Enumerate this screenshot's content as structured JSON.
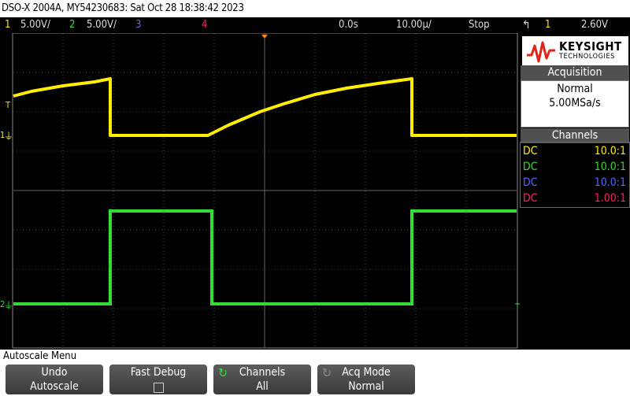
{
  "title": "DSO-X 2004A, MY54230683: Sat Oct 28 18:38:42 2023",
  "status": {
    "ch1_num": "1",
    "ch1_scale": "5.00V/",
    "ch2_num": "2",
    "ch2_scale": "5.00V/",
    "ch3_num": "3",
    "ch4_num": "4",
    "time_delay": "0.0s",
    "time_scale": "10.00µ/",
    "run_state": "Stop",
    "trig_source": "1",
    "trig_level": "2.60V"
  },
  "logo": {
    "brand": "KEYSIGHT",
    "sub": "TECHNOLOGIES"
  },
  "acquisition": {
    "header": "Acquisition",
    "mode": "Normal",
    "rate": "5.00MSa/s"
  },
  "channels_panel": {
    "header": "Channels",
    "rows": [
      {
        "coupling": "DC",
        "probe": "10.0:1",
        "color": "#ffee00"
      },
      {
        "coupling": "DC",
        "probe": "10.0:1",
        "color": "#33dd33"
      },
      {
        "coupling": "DC",
        "probe": "10.0:1",
        "color": "#5566ff"
      },
      {
        "coupling": "DC",
        "probe": "1.00:1",
        "color": "#ff2266"
      }
    ]
  },
  "markers": {
    "trigger": "T",
    "ch1": "1",
    "ch2": "2"
  },
  "menu_title": "Autoscale Menu",
  "softkeys": [
    {
      "line1": "Undo",
      "line2": "Autoscale"
    },
    {
      "line1": "Fast Debug",
      "line2": ""
    },
    {
      "line1": "Channels",
      "line2": "All"
    },
    {
      "line1": "Acq Mode",
      "line2": "Normal"
    }
  ],
  "colors": {
    "ch1": "#ffee00",
    "ch2": "#33dd33",
    "ch3": "#5566ff",
    "ch4": "#ff2266",
    "grid": "#555555",
    "trigger_marker": "#ff8800"
  }
}
